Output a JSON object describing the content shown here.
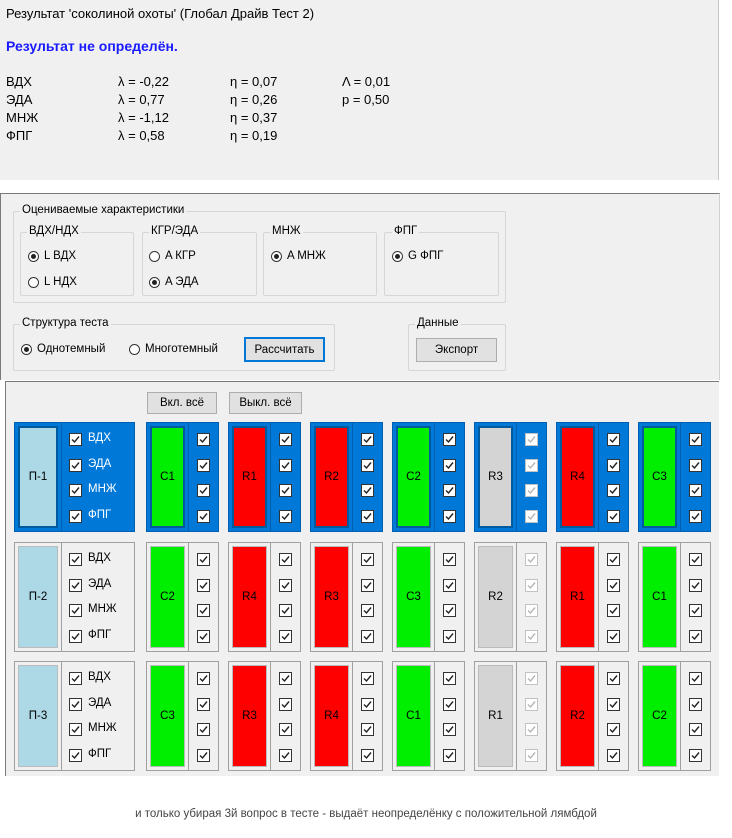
{
  "result": {
    "title": "Результат 'соколиной охоты' (Глобал Драйв Тест 2)",
    "status": "Результат не определён.",
    "rows": [
      {
        "name": "ВДХ",
        "lambda": "λ = -0,22",
        "eta": "η = 0,07",
        "extra": "Λ = 0,01"
      },
      {
        "name": "ЭДА",
        "lambda": "λ = 0,77",
        "eta": "η = 0,26",
        "extra": "p = 0,50"
      },
      {
        "name": "МНЖ",
        "lambda": "λ = -1,12",
        "eta": "η = 0,37",
        "extra": ""
      },
      {
        "name": "ФПГ",
        "lambda": "λ = 0,58",
        "eta": "η = 0,19",
        "extra": ""
      }
    ]
  },
  "settings": {
    "characteristics_legend": "Оцениваемые характеристики",
    "groups": [
      {
        "legend": "ВДХ/НДХ",
        "options": [
          {
            "label": "L ВДХ",
            "selected": true
          },
          {
            "label": "L НДХ",
            "selected": false
          }
        ]
      },
      {
        "legend": "КГР/ЭДА",
        "options": [
          {
            "label": "A КГР",
            "selected": false
          },
          {
            "label": "A ЭДА",
            "selected": true
          }
        ]
      },
      {
        "legend": "МНЖ",
        "options": [
          {
            "label": "A МНЖ",
            "selected": true
          }
        ]
      },
      {
        "legend": "ФПГ",
        "options": [
          {
            "label": "G ФПГ",
            "selected": true
          }
        ]
      }
    ],
    "structure_legend": "Структура теста",
    "structure_options": [
      {
        "label": "Однотемный",
        "selected": true
      },
      {
        "label": "Многотемный",
        "selected": false
      }
    ],
    "calculate_label": "Рассчитать",
    "data_legend": "Данные",
    "export_label": "Экспорт"
  },
  "grid": {
    "enable_all_label": "Вкл. всё",
    "disable_all_label": "Выкл. всё",
    "labels": [
      "ВДХ",
      "ЭДА",
      "МНЖ",
      "ФПГ"
    ],
    "colors": {
      "green": "#00ee00",
      "red": "#ff0000",
      "gray": "#d4d4d4",
      "blue": "#add8e6",
      "selected": "#0078d7"
    },
    "rows": [
      {
        "label": "П-1",
        "selected": true,
        "items": [
          {
            "name": "C1",
            "color": "green"
          },
          {
            "name": "R1",
            "color": "red"
          },
          {
            "name": "R2",
            "color": "red"
          },
          {
            "name": "C2",
            "color": "green"
          },
          {
            "name": "R3",
            "color": "gray"
          },
          {
            "name": "R4",
            "color": "red"
          },
          {
            "name": "C3",
            "color": "green"
          }
        ]
      },
      {
        "label": "П-2",
        "selected": false,
        "items": [
          {
            "name": "C2",
            "color": "green"
          },
          {
            "name": "R4",
            "color": "red"
          },
          {
            "name": "R3",
            "color": "red"
          },
          {
            "name": "C3",
            "color": "green"
          },
          {
            "name": "R2",
            "color": "gray"
          },
          {
            "name": "R1",
            "color": "red"
          },
          {
            "name": "C1",
            "color": "green"
          }
        ]
      },
      {
        "label": "П-3",
        "selected": false,
        "items": [
          {
            "name": "C3",
            "color": "green"
          },
          {
            "name": "R3",
            "color": "red"
          },
          {
            "name": "R4",
            "color": "red"
          },
          {
            "name": "C1",
            "color": "green"
          },
          {
            "name": "R1",
            "color": "gray"
          },
          {
            "name": "R2",
            "color": "red"
          },
          {
            "name": "C2",
            "color": "green"
          }
        ]
      }
    ]
  },
  "caption": "и только убирая 3й вопрос в тесте - выдаёт неопределёнку с положительной лямбдой"
}
